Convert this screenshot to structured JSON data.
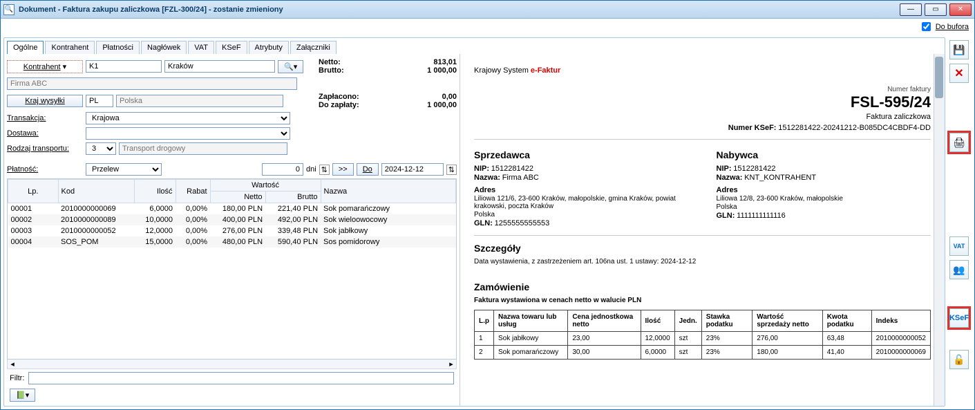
{
  "title": "Dokument - Faktura zakupu zaliczkowa [FZL-300/24]  - zostanie zmieniony",
  "titleIcon": "🔍",
  "windowButtons": {
    "min": "—",
    "max": "▭",
    "close": "✕"
  },
  "doBufora": {
    "label": "Do bufora",
    "checked": true
  },
  "tabs": [
    "Ogólne",
    "Kontrahent",
    "Płatności",
    "Nagłówek",
    "VAT",
    "KSeF",
    "Atrybuty",
    "Załączniki"
  ],
  "activeTab": 0,
  "form": {
    "kontrahentBtn": "Kontrahent",
    "kontrahentCode": "K1",
    "kontrahentCity": "Kraków",
    "kontrahentName": "Firma ABC",
    "krajWysylkiBtn": "Kraj wysyłki",
    "krajCode": "PL",
    "krajName": "Polska",
    "transakcjaLabel": "Transakcja:",
    "transakcjaVal": "Krajowa",
    "dostawaLabel": "Dostawa:",
    "dostawaVal": "",
    "rodzajTransLabel": "Rodzaj transportu:",
    "rodzajTransCode": "3",
    "rodzajTransName": "Transport drogowy",
    "platnoscLabel": "Płatność:",
    "platnoscVal": "Przelew",
    "dniVal": "0",
    "dniLabel": "dni",
    "fwdBtn": ">>",
    "doBtn": "Do",
    "dateVal": "2024-12-12"
  },
  "totals": {
    "nettoLabel": "Netto:",
    "nettoVal": "813,01",
    "bruttoLabel": "Brutto:",
    "bruttoVal": "1 000,00",
    "zapLabel": "Zapłacono:",
    "zapVal": "0,00",
    "doZapLabel": "Do zapłaty:",
    "doZapVal": "1 000,00"
  },
  "gridHeaders": {
    "lp": "Lp.",
    "kod": "Kod",
    "ilosc": "Ilość",
    "rabat": "Rabat",
    "wartosc": "Wartość",
    "netto": "Netto",
    "brutto": "Brutto",
    "nazwa": "Nazwa"
  },
  "rows": [
    {
      "lp": "00001",
      "kod": "2010000000069",
      "ilosc": "6,0000",
      "rabat": "0,00%",
      "netto": "180,00 PLN",
      "brutto": "221,40 PLN",
      "nazwa": "Sok pomarańczowy"
    },
    {
      "lp": "00002",
      "kod": "2010000000089",
      "ilosc": "10,0000",
      "rabat": "0,00%",
      "netto": "400,00 PLN",
      "brutto": "492,00 PLN",
      "nazwa": "Sok wieloowocowy"
    },
    {
      "lp": "00003",
      "kod": "2010000000052",
      "ilosc": "12,0000",
      "rabat": "0,00%",
      "netto": "276,00 PLN",
      "brutto": "339,48 PLN",
      "nazwa": "Sok jabłkowy"
    },
    {
      "lp": "00004",
      "kod": "SOS_POM",
      "ilosc": "15,0000",
      "rabat": "0,00%",
      "netto": "480,00 PLN",
      "brutto": "590,40 PLN",
      "nazwa": "Sos pomidorowy"
    }
  ],
  "filtrLabel": "Filtr:",
  "preview": {
    "heading1": "Krajowy System ",
    "heading2": "e-Faktur",
    "numerFakturyLabel": "Numer faktury",
    "numerFaktury": "FSL-595/24",
    "sub": "Faktura zaliczkowa",
    "ksefLabel": "Numer KSeF:",
    "ksefVal": "1512281422-20241212-B085DC4CBDF4-DD",
    "sprzedawca": "Sprzedawca",
    "nabywca": "Nabywca",
    "nipLabel": "NIP:",
    "nazwaLabel": "Nazwa:",
    "adresLabel": "Adres",
    "glnLabel": "GLN:",
    "s_nip": "1512281422",
    "s_nazwa": "Firma ABC",
    "s_adr1": "Liliowa 121/6, 23-600 Kraków, małopolskie, gmina Kraków, powiat krakowski, poczta Kraków",
    "s_adr2": "Polska",
    "s_gln": "1255555555553",
    "n_nip": "1512281422",
    "n_nazwa": "KNT_KONTRAHENT",
    "n_adr1": "Liliowa 12/8, 23-600 Kraków, małopolskie",
    "n_adr2": "Polska",
    "n_gln": "1111111111116",
    "szczegoly": "Szczegóły",
    "szczegolyLine": "Data wystawienia, z zastrzeżeniem art. 106na ust. 1 ustawy: 2024-12-12",
    "zamowienie": "Zamówienie",
    "zamowienieSub": "Faktura wystawiona w cenach netto w walucie PLN",
    "th": {
      "lp": "L.p",
      "nazwa": "Nazwa towaru lub usług",
      "cena": "Cena jednostkowa netto",
      "ilosc": "Ilość",
      "jedn": "Jedn.",
      "stawka": "Stawka podatku",
      "wart": "Wartość sprzedaży netto",
      "kwota": "Kwota podatku",
      "indeks": "Indeks"
    },
    "prows": [
      {
        "lp": "1",
        "nazwa": "Sok jabłkowy",
        "cena": "23,00",
        "ilosc": "12,0000",
        "jedn": "szt",
        "stawka": "23%",
        "wart": "276,00",
        "kwota": "63,48",
        "indeks": "2010000000052"
      },
      {
        "lp": "2",
        "nazwa": "Sok pomarańczowy",
        "cena": "30,00",
        "ilosc": "6,0000",
        "jedn": "szt",
        "stawka": "23%",
        "wart": "180,00",
        "kwota": "41,40",
        "indeks": "2010000000069"
      }
    ]
  },
  "sidebar": {
    "save": "💾",
    "close": "✕",
    "print": "🖨",
    "vat": "VAT",
    "people": "👥",
    "ksef": "KSeF",
    "lock": "🔓"
  }
}
